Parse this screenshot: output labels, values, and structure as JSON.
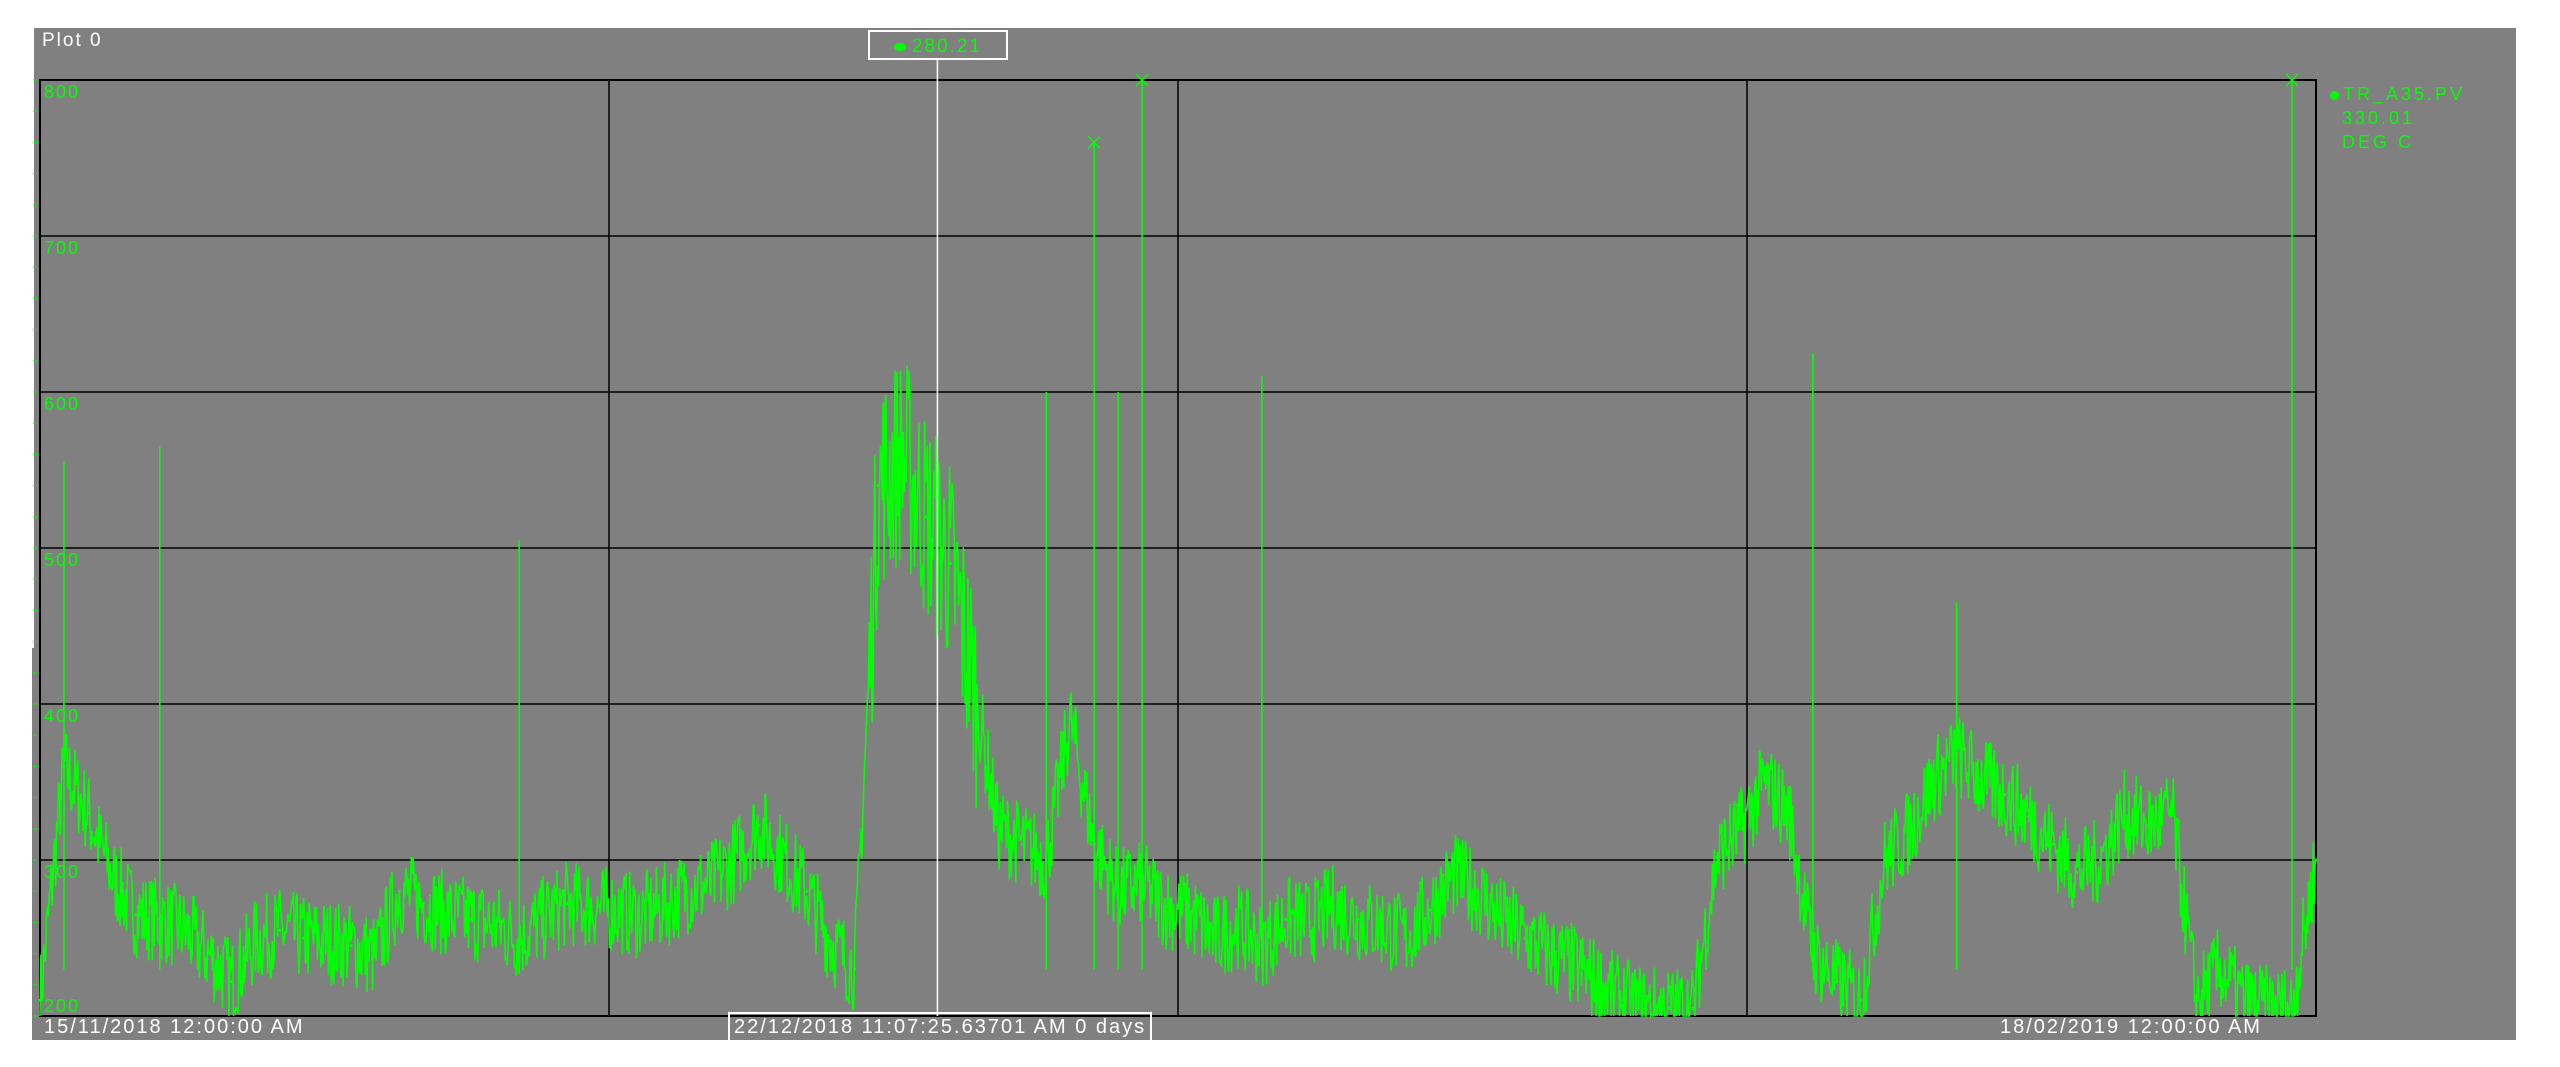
{
  "plot_title": "Plot 0",
  "cursor": {
    "value_label": "280.21",
    "time_label": "22/12/2018 11:07:25.63701 AM",
    "span_label": "0 days"
  },
  "colors": {
    "background": "#808080",
    "trace": "#00ff00",
    "grid": "#000000",
    "cursor_line": "#ffffff"
  },
  "chart_data": {
    "type": "line",
    "title": "",
    "xlabel": "",
    "ylabel": "",
    "x_start_label": "15/11/2018 12:00:00 AM",
    "x_end_label": "18/02/2019 12:00:00 AM",
    "x_range": [
      "2018-11-15",
      "2019-02-18"
    ],
    "ylim": [
      200,
      800
    ],
    "yticks": [
      "200",
      "300",
      "400",
      "500",
      "600",
      "700",
      "800"
    ],
    "grid": true,
    "legend_position": "right",
    "series": [
      {
        "name": "TR_A35.PV",
        "legend_value": "330.01",
        "legend_unit": "DEG C",
        "color": "#00ff00",
        "x": [
          "2018-11-15",
          "2018-11-16",
          "2018-11-17",
          "2018-11-18",
          "2018-11-19",
          "2018-11-20",
          "2018-11-21",
          "2018-11-22",
          "2018-11-23",
          "2018-11-24",
          "2018-11-25",
          "2018-11-26",
          "2018-11-27",
          "2018-11-28",
          "2018-11-29",
          "2018-11-30",
          "2018-12-01",
          "2018-12-02",
          "2018-12-03",
          "2018-12-04",
          "2018-12-05",
          "2018-12-06",
          "2018-12-07",
          "2018-12-08",
          "2018-12-09",
          "2018-12-10",
          "2018-12-11",
          "2018-12-12",
          "2018-12-13",
          "2018-12-14",
          "2018-12-15",
          "2018-12-16",
          "2018-12-17",
          "2018-12-18",
          "2018-12-19",
          "2018-12-20",
          "2018-12-21",
          "2018-12-22",
          "2018-12-23",
          "2018-12-24",
          "2018-12-25",
          "2018-12-26",
          "2018-12-27",
          "2018-12-28",
          "2018-12-29",
          "2018-12-30",
          "2018-12-31",
          "2019-01-01",
          "2019-01-02",
          "2019-01-03",
          "2019-01-04",
          "2019-01-05",
          "2019-01-06",
          "2019-01-07",
          "2019-01-08",
          "2019-01-09",
          "2019-01-10",
          "2019-01-11",
          "2019-01-12",
          "2019-01-13",
          "2019-01-14",
          "2019-01-15",
          "2019-01-16",
          "2019-01-17",
          "2019-01-18",
          "2019-01-19",
          "2019-01-20",
          "2019-01-21",
          "2019-01-22",
          "2019-01-23",
          "2019-01-24",
          "2019-01-25",
          "2019-01-26",
          "2019-01-27",
          "2019-01-28",
          "2019-01-29",
          "2019-01-30",
          "2019-01-31",
          "2019-02-01",
          "2019-02-02",
          "2019-02-03",
          "2019-02-04",
          "2019-02-05",
          "2019-02-06",
          "2019-02-07",
          "2019-02-08",
          "2019-02-09",
          "2019-02-10",
          "2019-02-11",
          "2019-02-12",
          "2019-02-13",
          "2019-02-14",
          "2019-02-15",
          "2019-02-16",
          "2019-02-17",
          "2019-02-18"
        ],
        "y": [
          210,
          360,
          330,
          290,
          265,
          262,
          255,
          240,
          222,
          248,
          255,
          250,
          248,
          245,
          238,
          280,
          272,
          265,
          262,
          258,
          250,
          262,
          272,
          270,
          268,
          264,
          270,
          280,
          285,
          300,
          322,
          302,
          280,
          248,
          230,
          540,
          560,
          520,
          490,
          410,
          320,
          310,
          300,
          390,
          310,
          280,
          285,
          270,
          265,
          250,
          258,
          245,
          262,
          260,
          270,
          262,
          258,
          250,
          268,
          290,
          280,
          262,
          250,
          240,
          232,
          222,
          210,
          205,
          205,
          205,
          302,
          320,
          350,
          330,
          240,
          222,
          210,
          300,
          318,
          350,
          368,
          352,
          342,
          328,
          310,
          292,
          300,
          330,
          322,
          330,
          210,
          230,
          210,
          205,
          205,
          300
        ]
      }
    ],
    "spikes": [
      {
        "x": "2018-11-16",
        "y": 555
      },
      {
        "x": "2018-11-20",
        "y": 565
      },
      {
        "x": "2018-12-05",
        "y": 505
      },
      {
        "x": "2018-12-27",
        "y": 600
      },
      {
        "x": "2018-12-29",
        "y": 760
      },
      {
        "x": "2018-12-30",
        "y": 600
      },
      {
        "x": "2018-12-31",
        "y": 800
      },
      {
        "x": "2019-01-05",
        "y": 610
      },
      {
        "x": "2019-01-28",
        "y": 625
      },
      {
        "x": "2019-02-03",
        "y": 465
      },
      {
        "x": "2019-02-17",
        "y": 800
      }
    ]
  }
}
